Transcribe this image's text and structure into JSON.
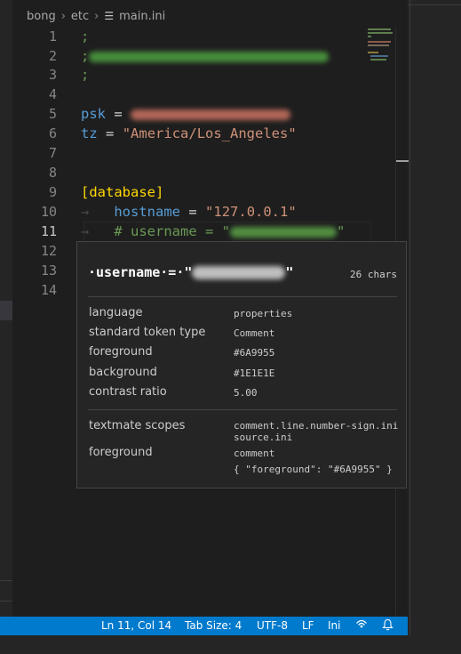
{
  "breadcrumb": {
    "parts": [
      "bong",
      "etc",
      "main.ini"
    ]
  },
  "editor": {
    "line_numbers": [
      "1",
      "2",
      "3",
      "4",
      "5",
      "6",
      "7",
      "8",
      "9",
      "10",
      "11",
      "12",
      "13",
      "14"
    ],
    "active_line": "11",
    "lines": {
      "l1": ";",
      "l2": ";",
      "l3": ";",
      "l5_key": "psk",
      "l5_eq": "=",
      "l6_key": "tz",
      "l6_eq": "=",
      "l6_val": "\"America/Los_Angeles\"",
      "l9": "[database]",
      "l10_key": "hostname",
      "l10_eq": "=",
      "l10_val": "\"127.0.0.1\"",
      "l11_start": "# username = \"",
      "l11_end": "\""
    }
  },
  "hover": {
    "token_prefix": "·username·=·\"",
    "token_suffix": "\"",
    "chars": "26 chars",
    "rows": [
      {
        "label": "language",
        "value": "properties"
      },
      {
        "label": "standard token type",
        "value": "Comment"
      },
      {
        "label": "foreground",
        "value": "#6A9955"
      },
      {
        "label": "background",
        "value": "#1E1E1E"
      },
      {
        "label": "contrast ratio",
        "value": "5.00"
      }
    ],
    "textmate_label": "textmate scopes",
    "textmate_scopes": [
      "comment.line.number-sign.ini",
      "source.ini"
    ],
    "tm_foreground_label": "foreground",
    "tm_foreground_value": "comment",
    "tm_foreground_rule": "{ \"foreground\": \"#6A9955\" }"
  },
  "statusbar": {
    "position": "Ln 11, Col 14",
    "tab_size": "Tab Size: 4",
    "encoding": "UTF-8",
    "eol": "LF",
    "language": "Ini"
  },
  "icons": {
    "breadcrumb_separator": "chevron-right-icon",
    "file": "lines-file-icon",
    "broadcast": "broadcast-icon",
    "notifications": "bell-icon"
  },
  "colors": {
    "statusbar_bg": "#007acc",
    "comment": "#6a9955",
    "string": "#ce9178",
    "keyword": "#569cd6",
    "bracket": "#ffd700"
  }
}
